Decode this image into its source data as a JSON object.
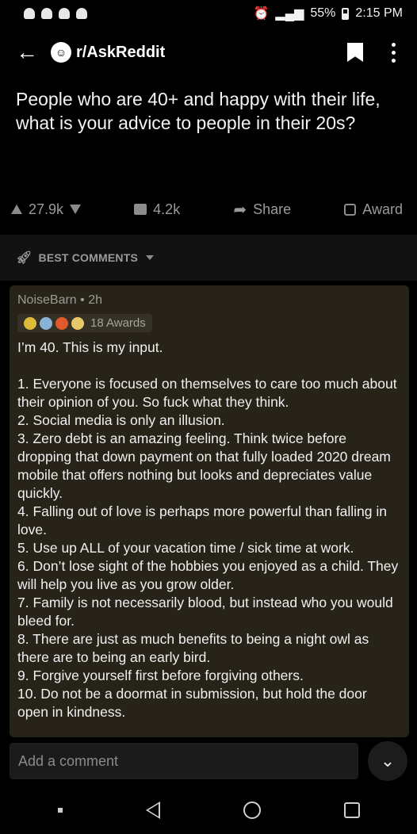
{
  "status_bar": {
    "battery": "55%",
    "time": "2:15 PM"
  },
  "header": {
    "subreddit": "r/AskReddit"
  },
  "post": {
    "title": "People who are 40+ and happy with their life, what is your advice to people in their 20s?",
    "upvotes": "27.9k",
    "comments": "4.2k",
    "share_label": "Share",
    "award_label": "Award"
  },
  "sort": {
    "label": "BEST COMMENTS"
  },
  "comment": {
    "meta": "NoiseBarn • 2h",
    "awards": "18 Awards",
    "intro": "I’m 40. This is my input.",
    "points": [
      "1. Everyone is focused on themselves to care too much about their opinion of you. So fuck what they think.",
      "2. Social media is only an illusion.",
      "3. Zero debt is an amazing feeling. Think twice before dropping that down payment on that fully loaded 2020 dream mobile that offers nothing but looks and depreciates value quickly.",
      "4. Falling out of love is perhaps more powerful than falling in love.",
      "5. Use up ALL of your vacation time / sick time at work.",
      "6. Don’t lose sight of the hobbies you enjoyed as a child. They will help you live as you grow older.",
      "7. Family is not necessarily blood, but instead who you would bleed for.",
      "8. There are just as much benefits to being a night owl as there are to being an early bird.",
      "9. Forgive yourself first before forgiving others.",
      "10. Do not be a doormat in submission, but hold the door open in kindness."
    ]
  },
  "footer": {
    "comment_placeholder": "Add a comment"
  },
  "icons": {
    "back": "back-arrow-icon",
    "bookmark": "bookmark-icon",
    "more": "more-vertical-icon",
    "upvote": "upvote-icon",
    "downvote": "downvote-icon",
    "comment": "comment-icon",
    "share": "share-icon",
    "award": "award-icon",
    "sort": "rocket-icon",
    "expand": "double-chevron-down-icon"
  }
}
